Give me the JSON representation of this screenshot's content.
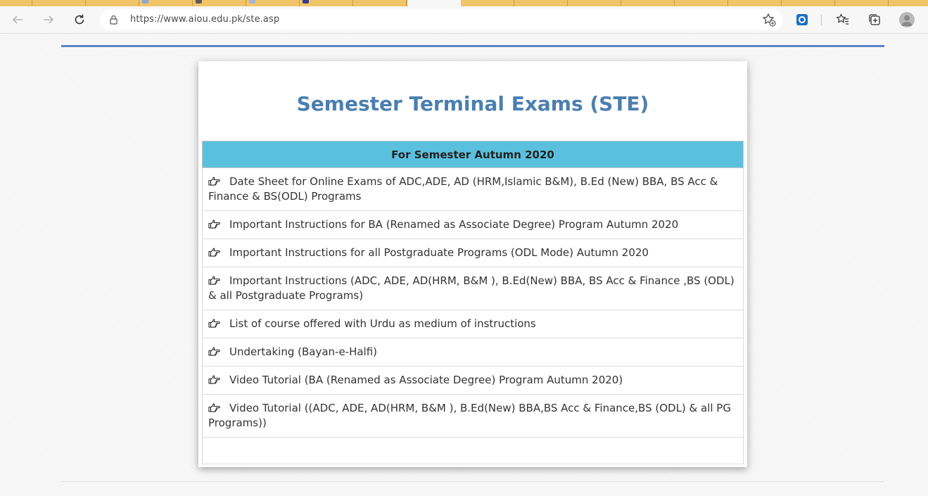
{
  "browser": {
    "url": "https://www.aiou.edu.pk/ste.asp",
    "back_icon": "back-arrow-icon",
    "forward_icon": "forward-arrow-icon",
    "refresh_icon": "refresh-icon",
    "tab_strip_color": "#f2c46a"
  },
  "page": {
    "title": "Semester Terminal Exams (STE)",
    "table_header": "For Semester Autumn 2020",
    "accent_color": "#4b7fb0",
    "header_color": "#5bc0de",
    "items": [
      {
        "label": "Date Sheet for Online Exams of ADC,ADE, AD (HRM,Islamic B&M), B.Ed (New) BBA, BS Acc & Finance & BS(ODL) Programs"
      },
      {
        "label": "Important Instructions for BA (Renamed as Associate Degree) Program Autumn 2020"
      },
      {
        "label": "Important Instructions for all Postgraduate Programs (ODL Mode) Autumn 2020"
      },
      {
        "label": "Important Instructions (ADC, ADE, AD(HRM, B&M ), B.Ed(New) BBA, BS Acc & Finance ,BS (ODL) & all Postgraduate Programs)"
      },
      {
        "label": "List of course offered with Urdu as medium of instructions"
      },
      {
        "label": "Undertaking (Bayan-e-Halfi)"
      },
      {
        "label": "Video Tutorial (BA (Renamed as Associate Degree) Program Autumn 2020)"
      },
      {
        "label": "Video Tutorial ((ADC, ADE, AD(HRM, B&M ), B.Ed(New) BBA,BS Acc & Finance,BS (ODL) & all PG Programs))"
      }
    ]
  }
}
